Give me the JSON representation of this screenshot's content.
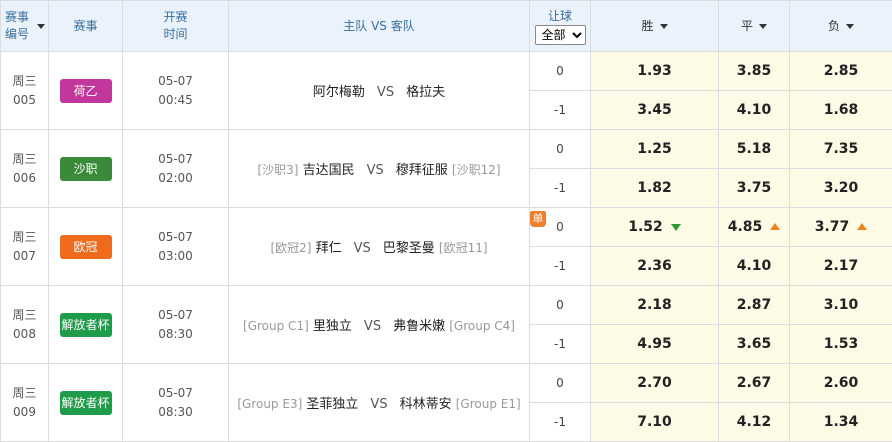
{
  "header": {
    "match_no": "赛事编号",
    "league": "赛事",
    "time": "开赛时间",
    "teams": "主队 VS 客队",
    "handicap": "让球",
    "handicap_select": "全部",
    "win": "胜",
    "draw": "平",
    "lose": "负"
  },
  "vs": "VS",
  "matches": [
    {
      "week": "周三",
      "num": "005",
      "league": "荷乙",
      "league_color": "#c2379b",
      "date": "05-07",
      "time": "00:45",
      "home_rank": "",
      "home": "阿尔梅勒",
      "away": "格拉夫",
      "away_rank": "",
      "rows": [
        {
          "h": "0",
          "w": "1.93",
          "d": "3.85",
          "l": "2.85"
        },
        {
          "h": "-1",
          "w": "3.45",
          "d": "4.10",
          "l": "1.68"
        }
      ]
    },
    {
      "week": "周三",
      "num": "006",
      "league": "沙职",
      "league_color": "#3a8a3a",
      "date": "05-07",
      "time": "02:00",
      "home_rank": "[沙职3]",
      "home": "吉达国民",
      "away": "穆拜征服",
      "away_rank": "[沙职12]",
      "rows": [
        {
          "h": "0",
          "w": "1.25",
          "d": "5.18",
          "l": "7.35"
        },
        {
          "h": "-1",
          "w": "1.82",
          "d": "3.75",
          "l": "3.20"
        }
      ]
    },
    {
      "week": "周三",
      "num": "007",
      "league": "欧冠",
      "league_color": "#f06a1c",
      "date": "05-07",
      "time": "03:00",
      "home_rank": "[欧冠2]",
      "home": "拜仁",
      "away": "巴黎圣曼",
      "away_rank": "[欧冠11]",
      "single": "单",
      "rows": [
        {
          "h": "0",
          "w": "1.52",
          "d": "4.85",
          "l": "3.77",
          "wt": "down",
          "dt": "up",
          "lt": "up"
        },
        {
          "h": "-1",
          "w": "2.36",
          "d": "4.10",
          "l": "2.17"
        }
      ]
    },
    {
      "week": "周三",
      "num": "008",
      "league": "解放者杯",
      "league_color": "#1e9c4a",
      "date": "05-07",
      "time": "08:30",
      "home_rank": "[Group C1]",
      "home": "里独立",
      "away": "弗鲁米嫩",
      "away_rank": "[Group C4]",
      "rows": [
        {
          "h": "0",
          "w": "2.18",
          "d": "2.87",
          "l": "3.10"
        },
        {
          "h": "-1",
          "w": "4.95",
          "d": "3.65",
          "l": "1.53"
        }
      ]
    },
    {
      "week": "周三",
      "num": "009",
      "league": "解放者杯",
      "league_color": "#1e9c4a",
      "date": "05-07",
      "time": "08:30",
      "home_rank": "[Group E3]",
      "home": "圣菲独立",
      "away": "科林蒂安",
      "away_rank": "[Group E1]",
      "rows": [
        {
          "h": "0",
          "w": "2.70",
          "d": "2.67",
          "l": "2.60"
        },
        {
          "h": "-1",
          "w": "7.10",
          "d": "4.12",
          "l": "1.34"
        }
      ]
    }
  ]
}
